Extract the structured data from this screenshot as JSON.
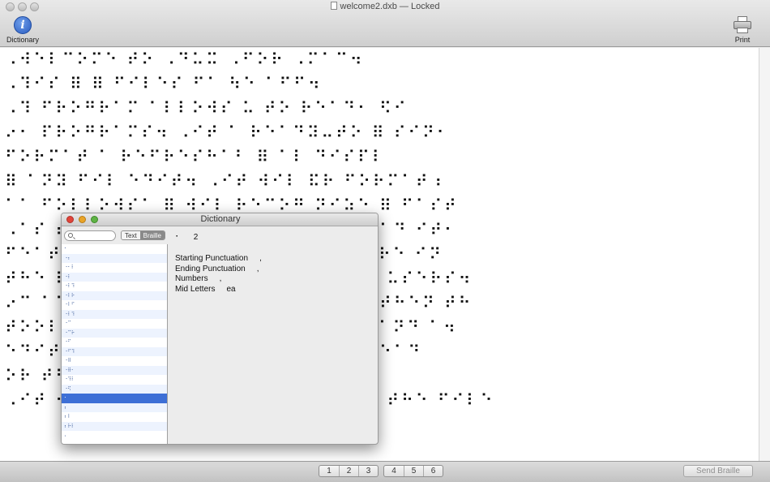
{
  "window": {
    "title": "welcome2.dxb",
    "status": "Locked",
    "separator": "—"
  },
  "toolbar": {
    "dictionary_label": "Dictionary",
    "print_label": "Print"
  },
  "document": {
    "lines": [
      "⠠⠺⠑⠇⠉⠕⠍⠑ ⠞⠕ ⠠⠙⠥⠭ ⠠⠋⠕⠗ ⠠⠍⠁⠉⠲",
      "⠠⠹⠊⠎ ⠿ ⠿ ⠋⠊⠇⠑⠎ ⠋⠁ ⠳⠑ ⠁⠋⠋⠲",
      "⠠⠹ ⠋⠗⠕⠛⠗⠁⠍ ⠁⠇⠇⠕⠺⠎ ⠥ ⠞⠕ ⠗⠑⠁⠙⠂ ⠫⠊",
      "⠔⠂ ⠏⠗⠕⠛⠗⠁⠍⠎⠲ ⠠⠊⠞ ⠁ ⠗⠑⠁⠙⠽⠤⠞⠕ ⠿ ⠎⠊⠝⠂",
      "⠋⠕⠗⠍⠁⠞ ⠁ ⠗⠑⠋⠗⠑⠎⠓⠁⠃ ⠿ ⠁⠇ ⠙⠊⠎⠏⠇",
      "⠿ ⠁⠝⠽ ⠋⠊⠇ ⠑⠙⠊⠞⠲ ⠠⠊⠞ ⠺⠊⠇ ⠯⠗ ⠋⠕⠗⠍⠁⠞⠰",
      "⠁⠁ ⠋⠕⠇⠇⠕⠺⠎⠁ ⠿ ⠺⠊⠇ ⠗⠑⠉⠕⠛ ⠝⠊⠵⠑ ⠿ ⠋⠁⠎⠞",
      "⠠⠁⠎ ⠞⠓⠑ ⠃⠗⠁⠊⠇⠇⠑ ⠊⠎ ⠥⠎⠑⠙ ⠞⠕ ⠗⠑⠁⠙ ⠊⠞⠂",
      "⠋⠑⠁⠞⠥⠗⠑⠎ ⠁⠝⠙ ⠉⠕⠝⠞⠗⠕⠇⠎ ⠞⠓⠁⠞ ⠁⠗⠑ ⠊⠝",
      "⠞⠓⠑ ⠿ ⠗⠑⠁⠙⠊⠝⠛ ⠊⠎ ⠑⠁⠎⠽ ⠋⠕⠗ ⠁⠇⠇ ⠥⠎⠑⠗⠎⠲",
      "⠔⠉ ⠁⠉⠉⠑⠎⠎ ⠞⠓⠑ ⠍⠑⠝⠥ ⠊⠞⠑⠍⠎ ⠁⠝⠙ ⠞⠓⠑⠝ ⠞⠓",
      "⠞⠕⠕⠇⠃⠁⠗ ⠁⠝⠙ ⠞⠓⠑ ⠏⠗⠑⠋⠑⠗⠑⠝⠉⠑⠎ ⠁⠝⠙ ⠁⠲",
      "⠑⠙⠊⠞ ⠁⠝⠙ ⠞⠓⠑ ⠺⠊⠝⠙⠕⠺ ⠍⠑⠝⠥⠎ ⠁ ⠗⠑⠁⠙",
      "⠕⠗ ⠞⠓⠑ ⠋⠊⠇⠑ ⠊⠎ ⠎⠁⠧⠑⠙",
      "⠠⠊⠞ ⠺⠊⠇⠇ ⠁⠇⠎⠕ ⠃⠑ ⠁⠃⠇⠑ ⠞⠕ ⠗⠑⠁⠙ ⠞⠓⠑ ⠋⠊⠇⠑"
    ]
  },
  "pages": {
    "group1": [
      "1",
      "2",
      "3"
    ],
    "group2": [
      "4",
      "5",
      "6"
    ]
  },
  "send_button": "Send Braille",
  "dictionary": {
    "title": "Dictionary",
    "search_placeholder": "",
    "toggle_text": "Text",
    "toggle_braille": "Braille",
    "list": [
      "⠂",
      "⠐⠆",
      "⠐⠂⠇",
      "⠐⠇",
      "⠐⠇⠹",
      "⠐⠇⠗",
      "⠐⠇⠋",
      "⠐⠇⠹",
      "⠐⠉",
      "⠐⠉⠗",
      "⠐⠋",
      "⠐⠋⠹",
      "⠐⠿",
      "⠐⠿⠂",
      "⠐⠹⠇",
      "⠐⠫",
      "⠂",
      "⠆",
      "⠆⠇",
      "⠆⠗⠇",
      "⠄"
    ],
    "selected_index": 16,
    "entry_symbol": "⠂",
    "entry_text": "2",
    "rules": [
      {
        "label": "Starting Punctuation",
        "value": ","
      },
      {
        "label": "Ending Punctuation",
        "value": ","
      },
      {
        "label": "Numbers",
        "value": ","
      },
      {
        "label": "Mid Letters",
        "value": "ea"
      }
    ]
  },
  "colors": {
    "selection": "#3d6fd6",
    "close": "#e0453a",
    "minimize": "#e9a428",
    "zoom": "#5fb344"
  }
}
